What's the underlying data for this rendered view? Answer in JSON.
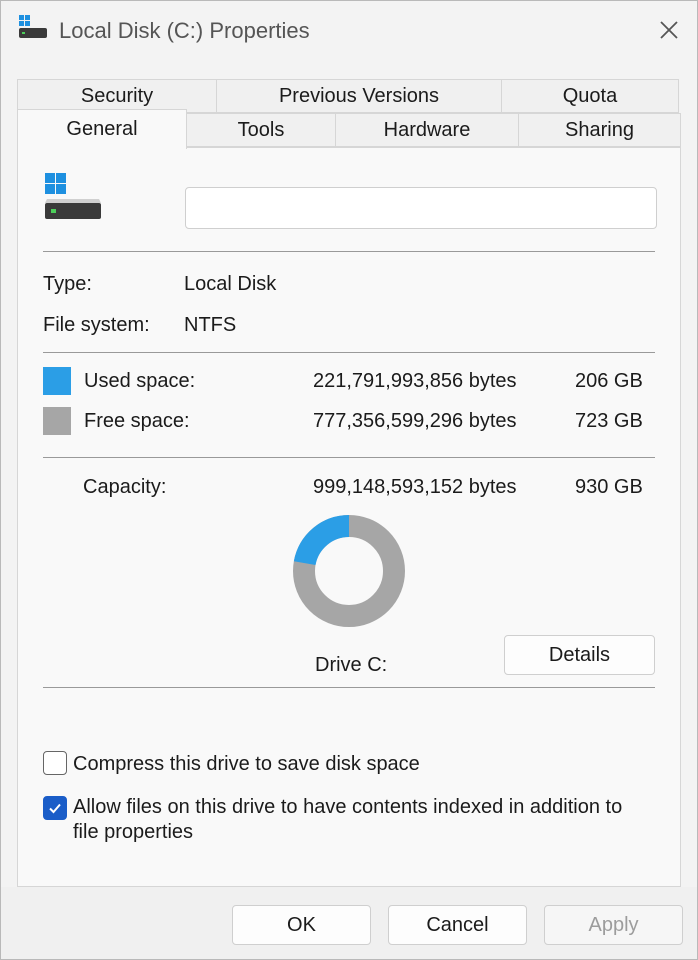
{
  "window": {
    "title": "Local Disk (C:) Properties"
  },
  "tabs": {
    "row_top": [
      "Security",
      "Previous Versions",
      "Quota"
    ],
    "row_bottom": [
      "General",
      "Tools",
      "Hardware",
      "Sharing"
    ],
    "active": "General"
  },
  "general": {
    "name_value": "",
    "type_label": "Type:",
    "type_value": "Local Disk",
    "fs_label": "File system:",
    "fs_value": "NTFS",
    "used_label": "Used space:",
    "used_bytes": "221,791,993,856 bytes",
    "used_gb": "206 GB",
    "free_label": "Free space:",
    "free_bytes": "777,356,599,296 bytes",
    "free_gb": "723 GB",
    "capacity_label": "Capacity:",
    "capacity_bytes": "999,148,593,152 bytes",
    "capacity_gb": "930 GB",
    "drive_label": "Drive C:",
    "details_button": "Details",
    "used_fraction": 0.222
  },
  "options": {
    "compress_label": "Compress this drive to save disk space",
    "compress_checked": false,
    "index_label_line1": "Allow files on this drive to have contents indexed in addition to",
    "index_label_line2": "file properties",
    "index_checked": true
  },
  "buttons": {
    "ok": "OK",
    "cancel": "Cancel",
    "apply": "Apply"
  },
  "colors": {
    "used": "#2b9ee6",
    "free": "#a6a6a6",
    "accent": "#1a5dc8"
  },
  "icons": {
    "title": "drive-icon",
    "close": "close-icon",
    "checkmark": "checkmark-icon"
  }
}
